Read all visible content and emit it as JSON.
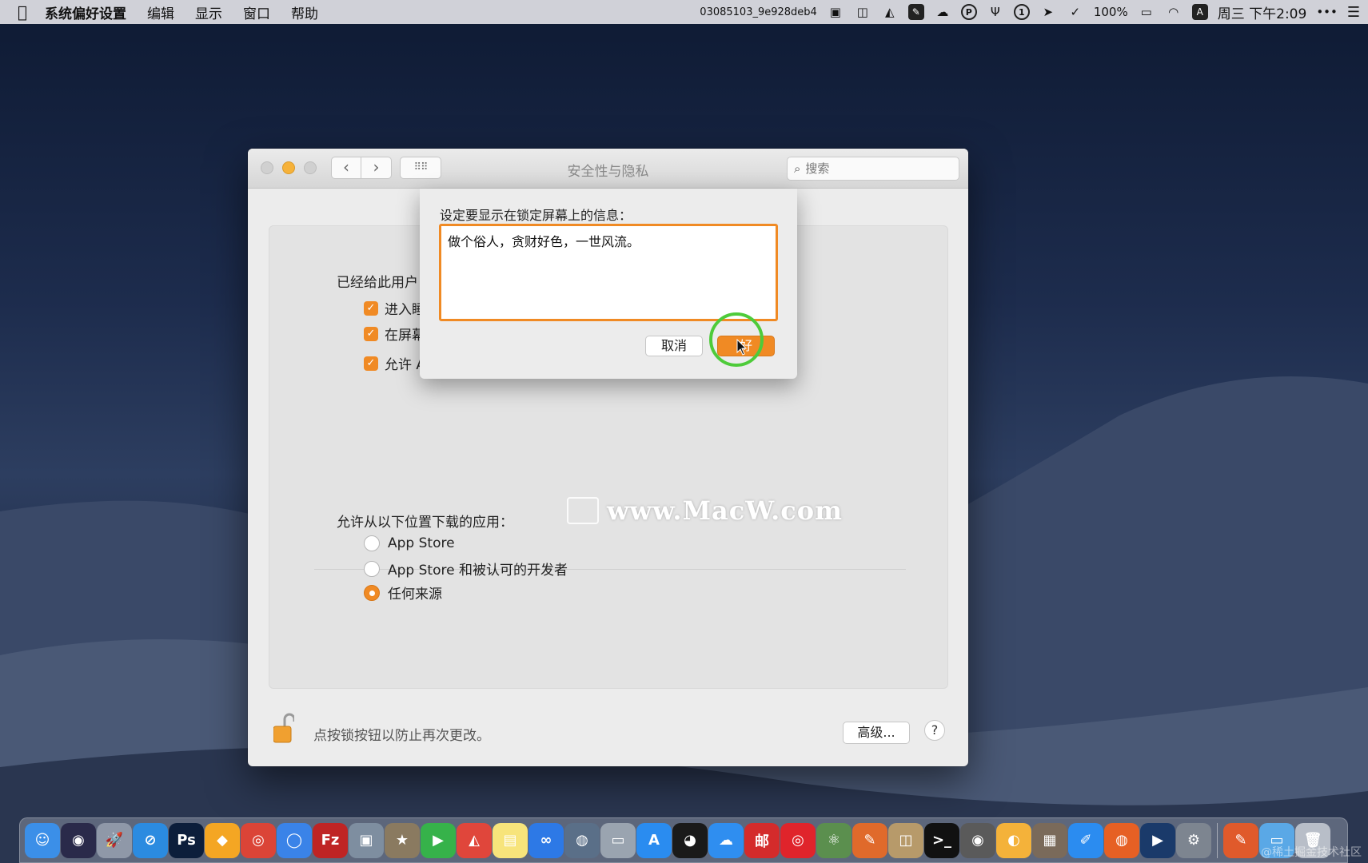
{
  "menubar": {
    "apple": "",
    "app_name": "系统偏好设置",
    "menus": [
      "编辑",
      "显示",
      "窗口",
      "帮助"
    ],
    "status_text": "03085103_9e928deb4",
    "battery": "100%",
    "input_source": "A",
    "clock": "周三 下午2:09",
    "more": "•••",
    "list": "☰"
  },
  "window": {
    "title": "安全性与隐私",
    "search_placeholder": "搜索",
    "nav_back": "‹",
    "nav_forward": "›",
    "grid": "⠿⠿"
  },
  "general": {
    "section_label": "已经给此用户",
    "checkboxes": [
      {
        "label": "进入睡",
        "checked": true
      },
      {
        "label": "在屏幕",
        "checked": true
      },
      {
        "label": "允许 A",
        "checked": true
      }
    ]
  },
  "downloads": {
    "label": "允许从以下位置下载的应用：",
    "options": [
      {
        "label": "App Store",
        "selected": false
      },
      {
        "label": "App Store 和被认可的开发者",
        "selected": false
      },
      {
        "label": "任何来源",
        "selected": true
      }
    ]
  },
  "watermark": "www.MacW.com",
  "footer": {
    "lock_text": "点按锁按钮以防止再次更改。",
    "advanced_button": "高级...",
    "help_button": "?"
  },
  "sheet": {
    "label": "设定要显示在锁定屏幕上的信息：",
    "message": "做个俗人，贪财好色，一世风流。",
    "cancel": "取消",
    "ok": "好"
  },
  "corner_watermark": "@稀土掘金技术社区",
  "colors": {
    "accent": "#f08a24",
    "click_ring": "#4ecb3a"
  },
  "dock": {
    "icons": [
      {
        "name": "finder-icon",
        "glyph": "☺",
        "bg": "#3b8fe8"
      },
      {
        "name": "siri-icon",
        "glyph": "◉",
        "bg": "#2a2a4a"
      },
      {
        "name": "launchpad-icon",
        "glyph": "🚀",
        "bg": "#8f98a8"
      },
      {
        "name": "safari-icon",
        "glyph": "⊘",
        "bg": "#2b8be0"
      },
      {
        "name": "photoshop-icon",
        "glyph": "Ps",
        "bg": "#0c1e3b"
      },
      {
        "name": "sketch-icon",
        "glyph": "◆",
        "bg": "#f4a623"
      },
      {
        "name": "chrome-icon",
        "glyph": "◎",
        "bg": "#db4437"
      },
      {
        "name": "browser-icon",
        "glyph": "◯",
        "bg": "#3a83e8"
      },
      {
        "name": "filezilla-icon",
        "glyph": "Fz",
        "bg": "#bf2424"
      },
      {
        "name": "preview-icon",
        "glyph": "▣",
        "bg": "#7e8ea0"
      },
      {
        "name": "package-icon",
        "glyph": "★",
        "bg": "#8a7a60"
      },
      {
        "name": "video-player-icon",
        "glyph": "▶",
        "bg": "#36b24a"
      },
      {
        "name": "ghost-app-icon",
        "glyph": "◭",
        "bg": "#e0463b"
      },
      {
        "name": "notes-icon",
        "glyph": "▤",
        "bg": "#f7e47b"
      },
      {
        "name": "baidu-netdisk-icon",
        "glyph": "∞",
        "bg": "#2d79e6"
      },
      {
        "name": "network-icon",
        "glyph": "◍",
        "bg": "#5a6f88"
      },
      {
        "name": "printer-icon",
        "glyph": "▭",
        "bg": "#9aa4b0"
      },
      {
        "name": "app-store-icon",
        "glyph": "A",
        "bg": "#2a8cf0"
      },
      {
        "name": "qq-icon",
        "glyph": "◕",
        "bg": "#1a1a1a"
      },
      {
        "name": "icloud-icon",
        "glyph": "☁",
        "bg": "#2f8ef0"
      },
      {
        "name": "mail-master-icon",
        "glyph": "邮",
        "bg": "#d42b2b"
      },
      {
        "name": "netease-music-icon",
        "glyph": "◎",
        "bg": "#e0242b"
      },
      {
        "name": "atom-icon",
        "glyph": "⚛",
        "bg": "#5b8f4e"
      },
      {
        "name": "brush-icon",
        "glyph": "✎",
        "bg": "#e06a2b"
      },
      {
        "name": "archive-icon",
        "glyph": "◫",
        "bg": "#b79a6a"
      },
      {
        "name": "terminal-icon",
        "glyph": ">_",
        "bg": "#111111"
      },
      {
        "name": "media-icon",
        "glyph": "◉",
        "bg": "#5a5a5a"
      },
      {
        "name": "folder-app-icon",
        "glyph": "◐",
        "bg": "#f4b23a"
      },
      {
        "name": "photos-icon",
        "glyph": "▦",
        "bg": "#7a6a5a"
      },
      {
        "name": "pen-icon",
        "glyph": "✐",
        "bg": "#2b8cf0"
      },
      {
        "name": "firefox-icon",
        "glyph": "◍",
        "bg": "#e66024"
      },
      {
        "name": "quicktime-icon",
        "glyph": "▶",
        "bg": "#1a3a6a"
      },
      {
        "name": "system-preferences-icon",
        "glyph": "⚙",
        "bg": "#7d8590"
      },
      {
        "name": "downloads-icon",
        "glyph": "✎",
        "bg": "#e05a2b"
      },
      {
        "name": "folder-icon",
        "glyph": "▭",
        "bg": "#5aa8e6"
      },
      {
        "name": "trash-icon",
        "glyph": "🗑",
        "bg": "#b8bec8"
      }
    ]
  }
}
